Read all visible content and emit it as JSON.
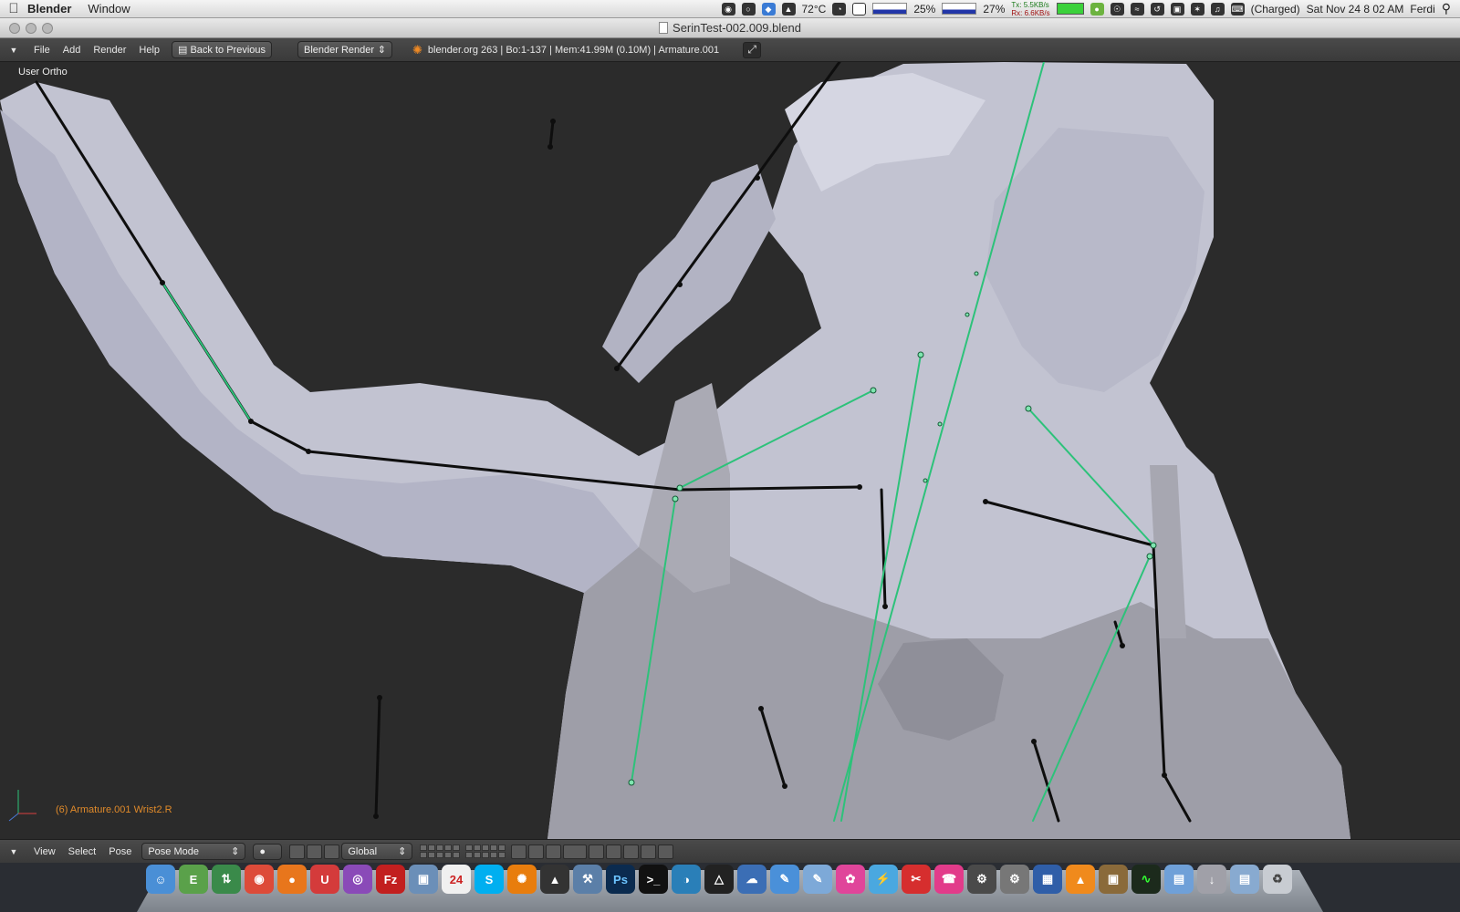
{
  "menubar": {
    "app": "Blender",
    "menus": [
      "Window"
    ],
    "temperature": "72°C",
    "cpu1": "25%",
    "cpu2": "27%",
    "tx": "Tx: 5.5KB/s",
    "rx": "Rx: 6.6KB/s",
    "battery": "(Charged)",
    "datetime": "Sat Nov 24  8 02 AM",
    "user": "Ferdi"
  },
  "window": {
    "title": "SerinTest-002.009.blend"
  },
  "header": {
    "menus": [
      "File",
      "Add",
      "Render",
      "Help"
    ],
    "back_button": "Back to Previous",
    "engine": "Blender Render",
    "info": "blender.org 263 | Bo:1-137  | Mem:41.99M (0.10M) | Armature.001"
  },
  "viewport": {
    "view_label": "User Ortho",
    "status": "(6) Armature.001 Wrist2.R",
    "colors": {
      "background": "#2b2b2b",
      "mesh": "#c4c4d2",
      "bone_selected": "#2dc27a",
      "bone": "#101010"
    }
  },
  "footer": {
    "menus": [
      "View",
      "Select",
      "Pose"
    ],
    "mode": "Pose Mode",
    "orientation": "Global"
  },
  "dock": {
    "icons": [
      "finder-icon",
      "evernote-icon",
      "network-icon",
      "chrome-icon",
      "firefox-icon",
      "magnet-icon",
      "web-icon",
      "filezilla-icon",
      "preview-icon",
      "calendar-icon",
      "skype-icon",
      "blender-icon",
      "inkscape-icon",
      "xcode-icon",
      "photoshop-icon",
      "terminal-icon",
      "globe-icon",
      "unity-icon",
      "wireshark-icon",
      "pencil-icon",
      "script-icon",
      "brain-icon",
      "flash-icon",
      "scissors-icon",
      "phone-icon",
      "steam-icon",
      "settings-icon",
      "calculator-icon",
      "vlc-icon",
      "photos-icon",
      "activity-icon",
      "folder-icon",
      "downloads-icon",
      "documents-icon",
      "trash-icon"
    ],
    "calendar_day": "24"
  }
}
